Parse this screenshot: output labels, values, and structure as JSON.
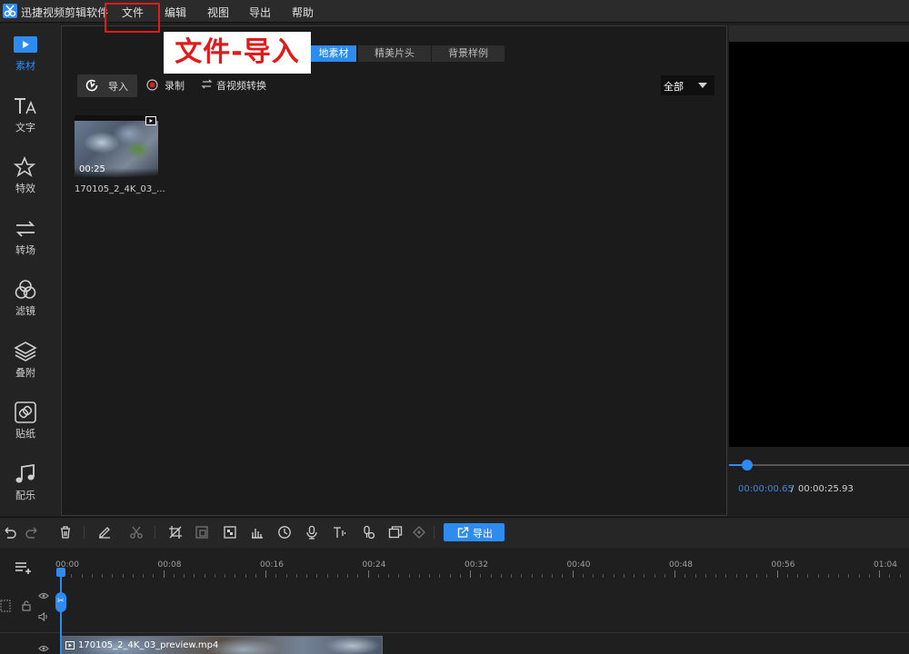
{
  "app": {
    "title": "迅捷视频剪辑软件"
  },
  "menu": [
    "文件",
    "编辑",
    "视图",
    "导出",
    "帮助"
  ],
  "annotation": "文件-导入",
  "sidebar": [
    {
      "label": "素材",
      "icon": "media-play-icon",
      "active": true
    },
    {
      "label": "文字",
      "icon": "text-icon",
      "active": false
    },
    {
      "label": "特效",
      "icon": "effects-star-icon",
      "active": false
    },
    {
      "label": "转场",
      "icon": "transition-icon",
      "active": false
    },
    {
      "label": "滤镜",
      "icon": "filter-circles-icon",
      "active": false
    },
    {
      "label": "叠附",
      "icon": "overlay-layers-icon",
      "active": false
    },
    {
      "label": "贴纸",
      "icon": "sticker-icon",
      "active": false
    },
    {
      "label": "配乐",
      "icon": "music-note-icon",
      "active": false
    }
  ],
  "panel": {
    "tabs": [
      {
        "label": "地素材",
        "active": true
      },
      {
        "label": "精美片头",
        "active": false
      },
      {
        "label": "背景样例",
        "active": false
      }
    ],
    "import_label": "导入",
    "record_label": "录制",
    "convert_label": "音视频转换",
    "filter_value": "全部",
    "media": [
      {
        "name": "170105_2_4K_03_...",
        "duration": "00:25"
      }
    ]
  },
  "preview": {
    "progress": 0.1,
    "time_current": "00:00:00.65",
    "time_separator": "/",
    "time_total": "00:00:25.93"
  },
  "toolbar": {
    "export_label": "导出",
    "tools": [
      "undo-icon",
      "redo-icon",
      "delete-icon",
      "edit-icon",
      "cut-icon",
      "crop-icon",
      "freeze-icon",
      "mosaic-icon",
      "audio-icon",
      "speed-clock-icon",
      "voiceover-mic-icon",
      "text-to-speech-icon",
      "voice-change-icon",
      "picture-in-picture-icon",
      "keyframe-icon"
    ]
  },
  "timeline": {
    "ruler_labels": [
      "00:00",
      "00:08",
      "00:16",
      "00:24",
      "00:32",
      "00:40",
      "00:48",
      "00:56",
      "01:04"
    ],
    "playhead_label": "✂",
    "clip_name": "170105_2_4K_03_preview.mp4"
  },
  "colors": {
    "accent": "#2e8bf0",
    "highlight": "#e01b1b",
    "background": "#1f1f1f"
  }
}
